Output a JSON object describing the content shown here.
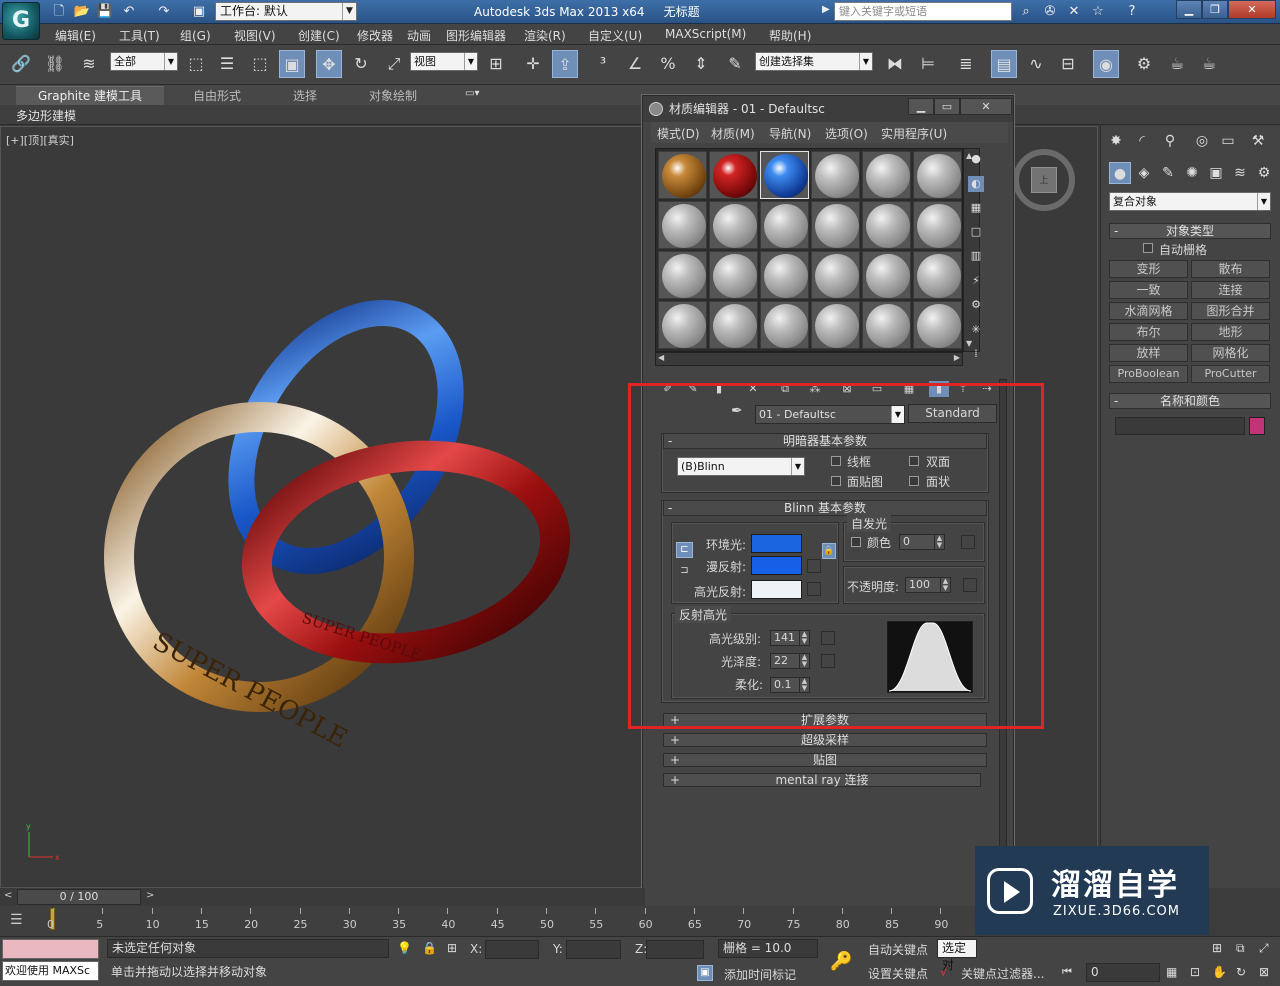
{
  "titlebar": {
    "workspace": "工作台: 默认",
    "app_title": "Autodesk 3ds Max  2013 x64",
    "file_title": "无标题",
    "search_placeholder": "键入关键字或短语"
  },
  "menubar": [
    "编辑(E)",
    "工具(T)",
    "组(G)",
    "视图(V)",
    "创建(C)",
    "修改器",
    "动画",
    "图形编辑器",
    "渲染(R)",
    "自定义(U)",
    "MAXScript(M)",
    "帮助(H)"
  ],
  "maintoolbar": {
    "filter": "全部",
    "ref_coord": "视图",
    "named_sel": "创建选择集"
  },
  "ribbon": {
    "tabs": [
      "Graphite 建模工具",
      "自由形式",
      "选择",
      "对象绘制"
    ],
    "sub_label": "多边形建模"
  },
  "viewport": {
    "label": "[+][顶][真实]",
    "ring_text": "SUPER PEOPLE"
  },
  "cmdpanel": {
    "category": "复合对象",
    "object_type_title": "对象类型",
    "auto_grid": "自动栅格",
    "buttons": [
      "变形",
      "散布",
      "一致",
      "连接",
      "水滴网格",
      "图形合并",
      "布尔",
      "地形",
      "放样",
      "网格化",
      "ProBoolean",
      "ProCutter"
    ],
    "name_color_title": "名称和颜色",
    "swatch_color": "#c0357a"
  },
  "mated": {
    "title": "材质编辑器 - 01 - Defaultsc",
    "menu": [
      "模式(D)",
      "材质(M)",
      "导航(N)",
      "选项(O)",
      "实用程序(U)"
    ],
    "material_name": "01 - Defaultsc",
    "material_type": "Standard",
    "shader_title": "明暗器基本参数",
    "shader": "(B)Blinn",
    "shader_options": [
      "线框",
      "双面",
      "面贴图",
      "面状"
    ],
    "blinn_title": "Blinn 基本参数",
    "self_illum_title": "自发光",
    "self_illum_color_label": "颜色",
    "self_illum_value": "0",
    "ambient_label": "环境光:",
    "diffuse_label": "漫反射:",
    "specular_label": "高光反射:",
    "ambient_color": "#1a66e0",
    "diffuse_color": "#1560e6",
    "specular_color": "#eef3f8",
    "opacity_label": "不透明度:",
    "opacity_value": "100",
    "spec_highlight_title": "反射高光",
    "spec_level_label": "高光级别:",
    "spec_level": "141",
    "gloss_label": "光泽度:",
    "gloss": "22",
    "soften_label": "柔化:",
    "soften": "0.1",
    "collapsed_rollouts": [
      "扩展参数",
      "超级采样",
      "贴图",
      "mental ray 连接"
    ]
  },
  "timeline": {
    "frame": "0 / 100",
    "ticks": [
      "0",
      "5",
      "10",
      "15",
      "20",
      "25",
      "30",
      "35",
      "40",
      "45",
      "50",
      "55",
      "60",
      "65",
      "70",
      "75",
      "80",
      "85",
      "90"
    ]
  },
  "status": {
    "welcome": "欢迎使用 MAXSc",
    "selection": "未选定任何对象",
    "prompt": "单击并拖动以选择并移动对象",
    "x_label": "X:",
    "y_label": "Y:",
    "z_label": "Z:",
    "grid": "栅格 = 10.0",
    "add_time_tag": "添加时间标记",
    "auto_key": "自动关键点",
    "set_key": "设置关键点",
    "selected_obj": "选定对",
    "key_filters": "关键点过滤器...",
    "frame_field": "0"
  },
  "watermark": {
    "title": "溜溜自学",
    "url": "ZIXUE.3D66.COM"
  }
}
